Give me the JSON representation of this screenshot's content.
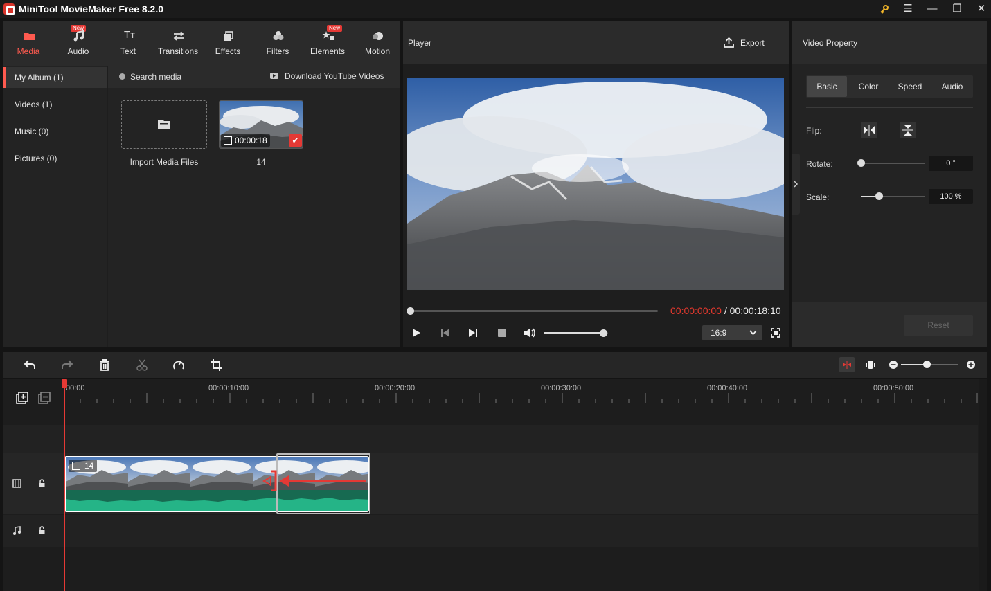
{
  "app": {
    "title": "MiniTool MovieMaker Free 8.2.0"
  },
  "toolbar": {
    "tabs": [
      {
        "label": "Media",
        "icon": "folder-icon",
        "active": true,
        "badge": ""
      },
      {
        "label": "Audio",
        "icon": "music-icon",
        "active": false,
        "badge": "New"
      },
      {
        "label": "Text",
        "icon": "text-icon",
        "active": false,
        "badge": ""
      },
      {
        "label": "Transitions",
        "icon": "transitions-icon",
        "active": false,
        "badge": ""
      },
      {
        "label": "Effects",
        "icon": "effects-icon",
        "active": false,
        "badge": ""
      },
      {
        "label": "Filters",
        "icon": "filters-icon",
        "active": false,
        "badge": ""
      },
      {
        "label": "Elements",
        "icon": "elements-icon",
        "active": false,
        "badge": "New"
      },
      {
        "label": "Motion",
        "icon": "motion-icon",
        "active": false,
        "badge": ""
      }
    ]
  },
  "sidebar": {
    "items": [
      {
        "label": "My Album (1)",
        "active": true
      },
      {
        "label": "Videos (1)",
        "active": false
      },
      {
        "label": "Music (0)",
        "active": false
      },
      {
        "label": "Pictures (0)",
        "active": false
      }
    ]
  },
  "media": {
    "search_label": "Search media",
    "download_label": "Download YouTube Videos",
    "import_label": "Import Media Files",
    "clip": {
      "name": "14",
      "duration": "00:00:18"
    }
  },
  "player": {
    "title": "Player",
    "export_label": "Export",
    "time_current": "00:00:00:00",
    "time_separator": " / ",
    "time_total": "00:00:18:10",
    "aspect": "16:9",
    "volume_level": 0.92,
    "progress": 0
  },
  "property": {
    "title": "Video Property",
    "tabs": [
      "Basic",
      "Color",
      "Speed",
      "Audio"
    ],
    "active_tab": "Basic",
    "flip_label": "Flip:",
    "rotate_label": "Rotate:",
    "rotate_value": "0 °",
    "rotate_level": 0,
    "scale_label": "Scale:",
    "scale_value": "100 %",
    "scale_level": 0.28,
    "reset_label": "Reset"
  },
  "timeline": {
    "ruler_labels": [
      "00:00",
      "00:00:10:00",
      "00:00:20:00",
      "00:00:30:00",
      "00:00:40:00",
      "00:00:50:00"
    ],
    "clip_label": "14",
    "zoom_level": 0.45
  },
  "colors": {
    "accent": "#ff5a4f",
    "time_red": "#e8392e",
    "audio_green": "#1fae7e",
    "gold": "#f0b429"
  }
}
